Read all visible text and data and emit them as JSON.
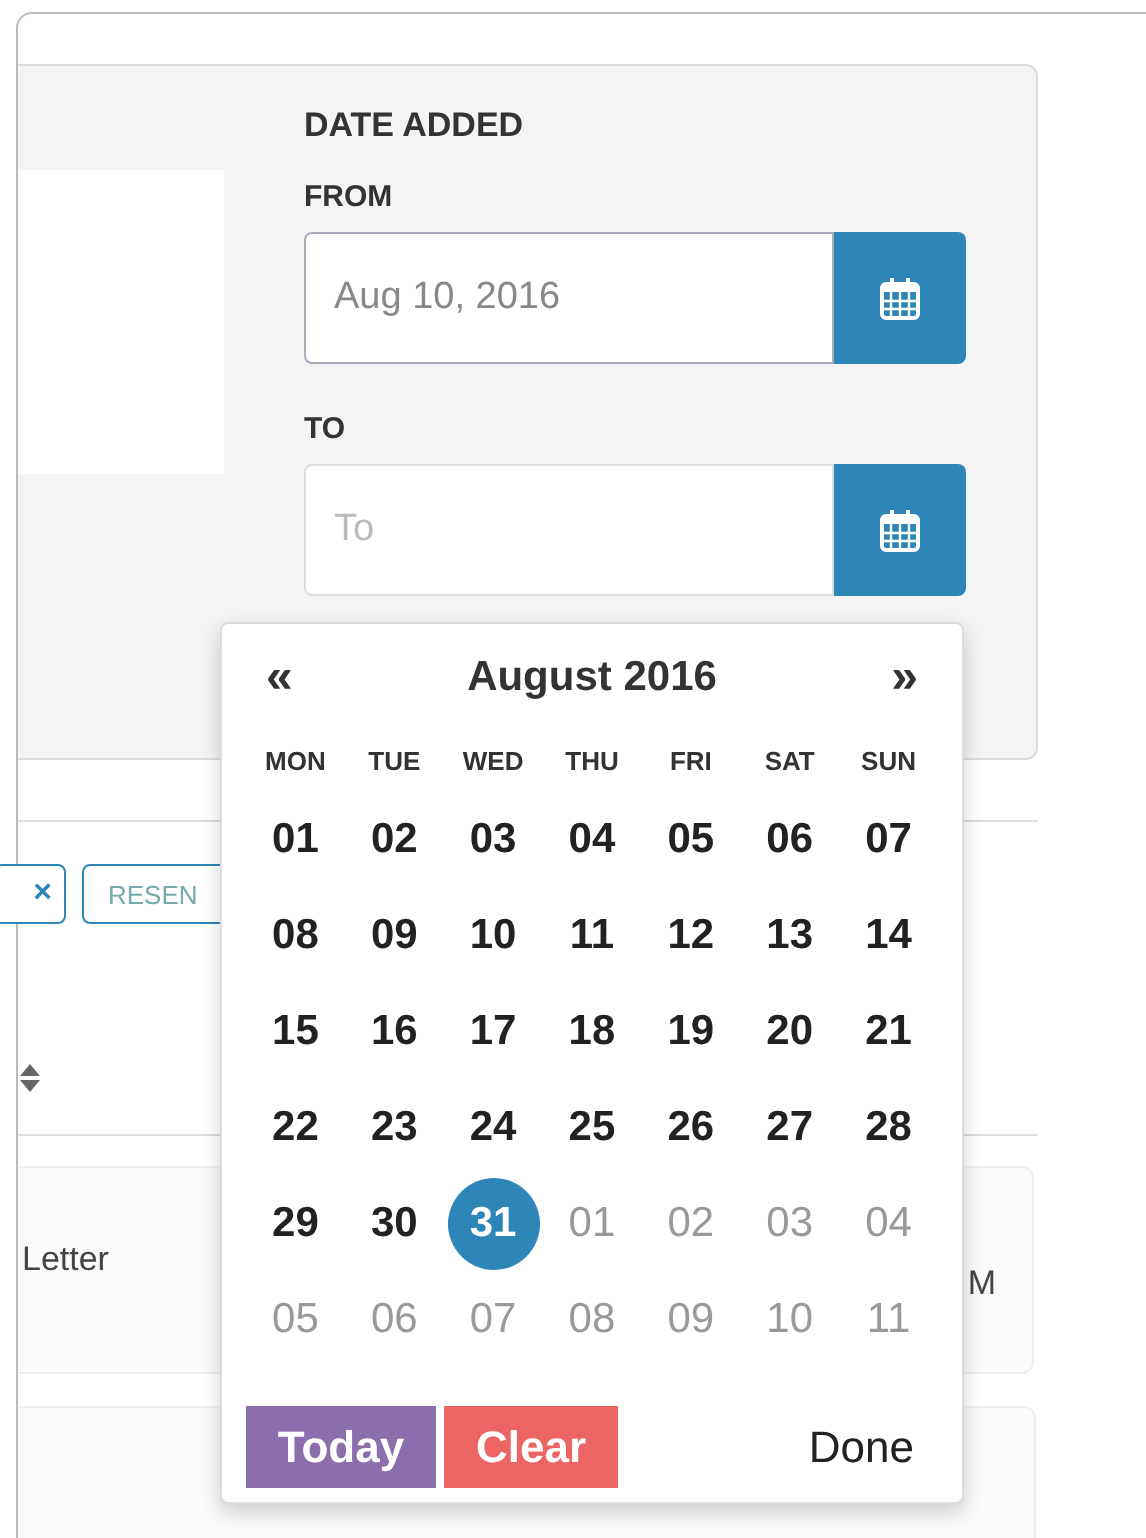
{
  "filter": {
    "title": "DATE ADDED",
    "from": {
      "label": "FROM",
      "value": "Aug 10, 2016"
    },
    "to": {
      "label": "TO",
      "placeholder": "To"
    }
  },
  "actions": [
    {
      "kind": "remove",
      "label": "×"
    },
    {
      "kind": "text",
      "label": "RESEN"
    }
  ],
  "rows": [
    {
      "column_1": "Letter",
      "column_2": "M"
    }
  ],
  "datepicker": {
    "prev": "«",
    "title": "August 2016",
    "next": "»",
    "weekdays": [
      "MON",
      "TUE",
      "WED",
      "THU",
      "FRI",
      "SAT",
      "SUN"
    ],
    "weeks": [
      [
        {
          "day": "01",
          "muted": false,
          "selected": false
        },
        {
          "day": "02",
          "muted": false,
          "selected": false
        },
        {
          "day": "03",
          "muted": false,
          "selected": false
        },
        {
          "day": "04",
          "muted": false,
          "selected": false
        },
        {
          "day": "05",
          "muted": false,
          "selected": false
        },
        {
          "day": "06",
          "muted": false,
          "selected": false
        },
        {
          "day": "07",
          "muted": false,
          "selected": false
        }
      ],
      [
        {
          "day": "08",
          "muted": false,
          "selected": false
        },
        {
          "day": "09",
          "muted": false,
          "selected": false
        },
        {
          "day": "10",
          "muted": false,
          "selected": false
        },
        {
          "day": "11",
          "muted": false,
          "selected": false
        },
        {
          "day": "12",
          "muted": false,
          "selected": false
        },
        {
          "day": "13",
          "muted": false,
          "selected": false
        },
        {
          "day": "14",
          "muted": false,
          "selected": false
        }
      ],
      [
        {
          "day": "15",
          "muted": false,
          "selected": false
        },
        {
          "day": "16",
          "muted": false,
          "selected": false
        },
        {
          "day": "17",
          "muted": false,
          "selected": false
        },
        {
          "day": "18",
          "muted": false,
          "selected": false
        },
        {
          "day": "19",
          "muted": false,
          "selected": false
        },
        {
          "day": "20",
          "muted": false,
          "selected": false
        },
        {
          "day": "21",
          "muted": false,
          "selected": false
        }
      ],
      [
        {
          "day": "22",
          "muted": false,
          "selected": false
        },
        {
          "day": "23",
          "muted": false,
          "selected": false
        },
        {
          "day": "24",
          "muted": false,
          "selected": false
        },
        {
          "day": "25",
          "muted": false,
          "selected": false
        },
        {
          "day": "26",
          "muted": false,
          "selected": false
        },
        {
          "day": "27",
          "muted": false,
          "selected": false
        },
        {
          "day": "28",
          "muted": false,
          "selected": false
        }
      ],
      [
        {
          "day": "29",
          "muted": false,
          "selected": false
        },
        {
          "day": "30",
          "muted": false,
          "selected": false
        },
        {
          "day": "31",
          "muted": false,
          "selected": true
        },
        {
          "day": "01",
          "muted": true,
          "selected": false
        },
        {
          "day": "02",
          "muted": true,
          "selected": false
        },
        {
          "day": "03",
          "muted": true,
          "selected": false
        },
        {
          "day": "04",
          "muted": true,
          "selected": false
        }
      ],
      [
        {
          "day": "05",
          "muted": true,
          "selected": false
        },
        {
          "day": "06",
          "muted": true,
          "selected": false
        },
        {
          "day": "07",
          "muted": true,
          "selected": false
        },
        {
          "day": "08",
          "muted": true,
          "selected": false
        },
        {
          "day": "09",
          "muted": true,
          "selected": false
        },
        {
          "day": "10",
          "muted": true,
          "selected": false
        },
        {
          "day": "11",
          "muted": true,
          "selected": false
        }
      ]
    ],
    "buttons": [
      {
        "kind": "today",
        "label": "Today"
      },
      {
        "kind": "clear",
        "label": "Clear"
      },
      {
        "kind": "done",
        "label": "Done"
      }
    ]
  }
}
